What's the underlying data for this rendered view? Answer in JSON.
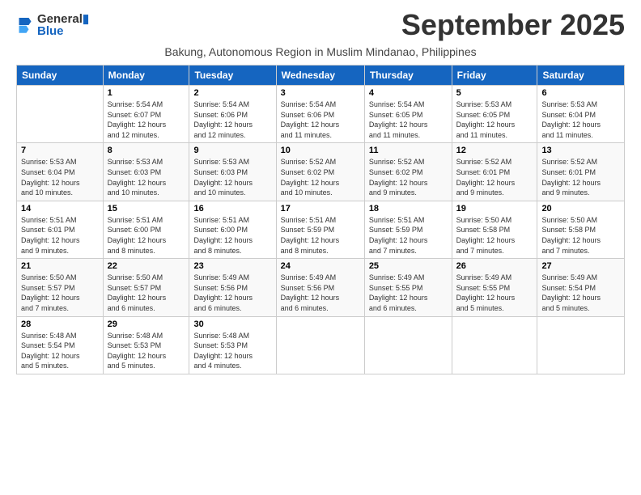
{
  "logo": {
    "line1": "General",
    "line2": "Blue"
  },
  "title": "September 2025",
  "subtitle": "Bakung, Autonomous Region in Muslim Mindanao, Philippines",
  "weekdays": [
    "Sunday",
    "Monday",
    "Tuesday",
    "Wednesday",
    "Thursday",
    "Friday",
    "Saturday"
  ],
  "weeks": [
    [
      {
        "day": "",
        "info": ""
      },
      {
        "day": "1",
        "info": "Sunrise: 5:54 AM\nSunset: 6:07 PM\nDaylight: 12 hours\nand 12 minutes."
      },
      {
        "day": "2",
        "info": "Sunrise: 5:54 AM\nSunset: 6:06 PM\nDaylight: 12 hours\nand 12 minutes."
      },
      {
        "day": "3",
        "info": "Sunrise: 5:54 AM\nSunset: 6:06 PM\nDaylight: 12 hours\nand 11 minutes."
      },
      {
        "day": "4",
        "info": "Sunrise: 5:54 AM\nSunset: 6:05 PM\nDaylight: 12 hours\nand 11 minutes."
      },
      {
        "day": "5",
        "info": "Sunrise: 5:53 AM\nSunset: 6:05 PM\nDaylight: 12 hours\nand 11 minutes."
      },
      {
        "day": "6",
        "info": "Sunrise: 5:53 AM\nSunset: 6:04 PM\nDaylight: 12 hours\nand 11 minutes."
      }
    ],
    [
      {
        "day": "7",
        "info": "Sunrise: 5:53 AM\nSunset: 6:04 PM\nDaylight: 12 hours\nand 10 minutes."
      },
      {
        "day": "8",
        "info": "Sunrise: 5:53 AM\nSunset: 6:03 PM\nDaylight: 12 hours\nand 10 minutes."
      },
      {
        "day": "9",
        "info": "Sunrise: 5:53 AM\nSunset: 6:03 PM\nDaylight: 12 hours\nand 10 minutes."
      },
      {
        "day": "10",
        "info": "Sunrise: 5:52 AM\nSunset: 6:02 PM\nDaylight: 12 hours\nand 10 minutes."
      },
      {
        "day": "11",
        "info": "Sunrise: 5:52 AM\nSunset: 6:02 PM\nDaylight: 12 hours\nand 9 minutes."
      },
      {
        "day": "12",
        "info": "Sunrise: 5:52 AM\nSunset: 6:01 PM\nDaylight: 12 hours\nand 9 minutes."
      },
      {
        "day": "13",
        "info": "Sunrise: 5:52 AM\nSunset: 6:01 PM\nDaylight: 12 hours\nand 9 minutes."
      }
    ],
    [
      {
        "day": "14",
        "info": "Sunrise: 5:51 AM\nSunset: 6:01 PM\nDaylight: 12 hours\nand 9 minutes."
      },
      {
        "day": "15",
        "info": "Sunrise: 5:51 AM\nSunset: 6:00 PM\nDaylight: 12 hours\nand 8 minutes."
      },
      {
        "day": "16",
        "info": "Sunrise: 5:51 AM\nSunset: 6:00 PM\nDaylight: 12 hours\nand 8 minutes."
      },
      {
        "day": "17",
        "info": "Sunrise: 5:51 AM\nSunset: 5:59 PM\nDaylight: 12 hours\nand 8 minutes."
      },
      {
        "day": "18",
        "info": "Sunrise: 5:51 AM\nSunset: 5:59 PM\nDaylight: 12 hours\nand 7 minutes."
      },
      {
        "day": "19",
        "info": "Sunrise: 5:50 AM\nSunset: 5:58 PM\nDaylight: 12 hours\nand 7 minutes."
      },
      {
        "day": "20",
        "info": "Sunrise: 5:50 AM\nSunset: 5:58 PM\nDaylight: 12 hours\nand 7 minutes."
      }
    ],
    [
      {
        "day": "21",
        "info": "Sunrise: 5:50 AM\nSunset: 5:57 PM\nDaylight: 12 hours\nand 7 minutes."
      },
      {
        "day": "22",
        "info": "Sunrise: 5:50 AM\nSunset: 5:57 PM\nDaylight: 12 hours\nand 6 minutes."
      },
      {
        "day": "23",
        "info": "Sunrise: 5:49 AM\nSunset: 5:56 PM\nDaylight: 12 hours\nand 6 minutes."
      },
      {
        "day": "24",
        "info": "Sunrise: 5:49 AM\nSunset: 5:56 PM\nDaylight: 12 hours\nand 6 minutes."
      },
      {
        "day": "25",
        "info": "Sunrise: 5:49 AM\nSunset: 5:55 PM\nDaylight: 12 hours\nand 6 minutes."
      },
      {
        "day": "26",
        "info": "Sunrise: 5:49 AM\nSunset: 5:55 PM\nDaylight: 12 hours\nand 5 minutes."
      },
      {
        "day": "27",
        "info": "Sunrise: 5:49 AM\nSunset: 5:54 PM\nDaylight: 12 hours\nand 5 minutes."
      }
    ],
    [
      {
        "day": "28",
        "info": "Sunrise: 5:48 AM\nSunset: 5:54 PM\nDaylight: 12 hours\nand 5 minutes."
      },
      {
        "day": "29",
        "info": "Sunrise: 5:48 AM\nSunset: 5:53 PM\nDaylight: 12 hours\nand 5 minutes."
      },
      {
        "day": "30",
        "info": "Sunrise: 5:48 AM\nSunset: 5:53 PM\nDaylight: 12 hours\nand 4 minutes."
      },
      {
        "day": "",
        "info": ""
      },
      {
        "day": "",
        "info": ""
      },
      {
        "day": "",
        "info": ""
      },
      {
        "day": "",
        "info": ""
      }
    ]
  ]
}
